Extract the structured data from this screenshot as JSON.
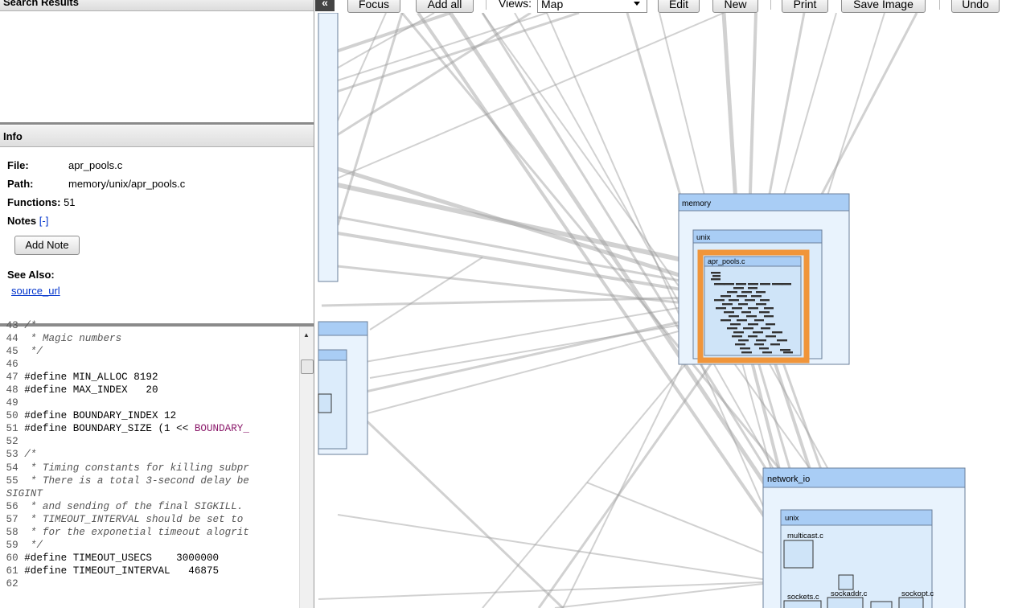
{
  "search": {
    "title": "Search Results"
  },
  "info": {
    "title": "Info",
    "file_label": "File:",
    "file_value": "apr_pools.c",
    "path_label": "Path:",
    "path_value": "memory/unix/apr_pools.c",
    "functions_label": "Functions:",
    "functions_value": "51",
    "notes_label": "Notes",
    "notes_toggle": "[-]",
    "add_note": "Add Note",
    "see_also_label": "See Also:",
    "source_link": "source_url"
  },
  "code": {
    "lines": [
      {
        "n": "43",
        "t": "/*",
        "c": "cm"
      },
      {
        "n": "44",
        "t": " * Magic numbers",
        "c": "cm"
      },
      {
        "n": "45",
        "t": " */",
        "c": "cm"
      },
      {
        "n": "46",
        "t": "",
        "c": ""
      },
      {
        "n": "47",
        "t": "#define MIN_ALLOC 8192",
        "c": ""
      },
      {
        "n": "48",
        "t": "#define MAX_INDEX   20",
        "c": ""
      },
      {
        "n": "49",
        "t": "",
        "c": ""
      },
      {
        "n": "50",
        "t": "#define BOUNDARY_INDEX 12",
        "c": ""
      },
      {
        "n": "51",
        "t": "#define BOUNDARY_SIZE (1 << ",
        "c": "",
        "m": "BOUNDARY_"
      },
      {
        "n": "52",
        "t": "",
        "c": ""
      },
      {
        "n": "53",
        "t": "/*",
        "c": "cm"
      },
      {
        "n": "54",
        "t": " * Timing constants for killing subpr",
        "c": "cm"
      },
      {
        "n": "55",
        "t": " * There is a total 3-second delay be",
        "c": "cm"
      },
      {
        "n": "",
        "t": "SIGINT",
        "c": "cm"
      },
      {
        "n": "56",
        "t": " * and sending of the final SIGKILL.",
        "c": "cm"
      },
      {
        "n": "57",
        "t": " * TIMEOUT_INTERVAL should be set to",
        "c": "cm"
      },
      {
        "n": "58",
        "t": " * for the exponetial timeout alogrit",
        "c": "cm"
      },
      {
        "n": "59",
        "t": " */",
        "c": "cm"
      },
      {
        "n": "60",
        "t": "#define TIMEOUT_USECS    3000000",
        "c": ""
      },
      {
        "n": "61",
        "t": "#define TIMEOUT_INTERVAL   46875",
        "c": ""
      },
      {
        "n": "62",
        "t": "",
        "c": ""
      }
    ]
  },
  "toolbar": {
    "collapse": "«",
    "focus": "Focus",
    "add_all": "Add all",
    "views_label": "Views:",
    "views_value": "Map",
    "edit": "Edit",
    "new": "New",
    "print": "Print",
    "save_image": "Save Image",
    "undo": "Undo"
  },
  "map": {
    "memory": "memory",
    "memory_unix": "unix",
    "apr_pools": "apr_pools.c",
    "network_io": "network_io",
    "net_unix": "unix",
    "multicast": "multicast.c",
    "sockets": "sockets.c",
    "sockaddr": "sockaddr.c",
    "sockopt": "sockopt.c"
  },
  "colors": {
    "highlight": "#f0953a",
    "box_header": "#a9cdf5",
    "box_fill": "#e9f3fd",
    "edge": "#9a9a9a"
  }
}
